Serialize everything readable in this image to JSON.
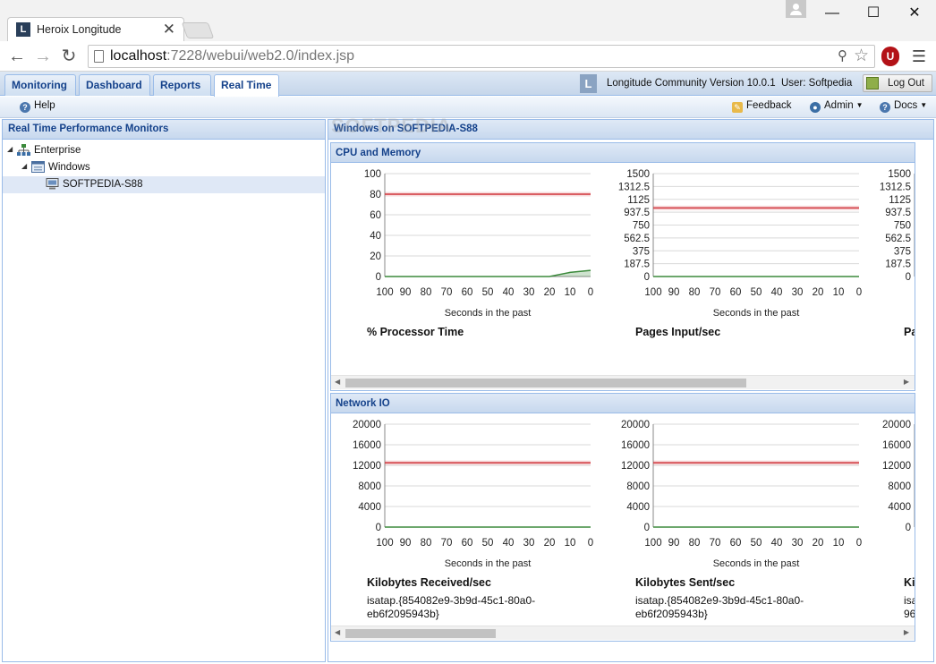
{
  "browser": {
    "tab_title": "Heroix Longitude",
    "tab_close": "✕",
    "favicon_letter": "L",
    "url_host": "localhost",
    "url_rest": ":7228/webui/web2.0/index.jsp"
  },
  "app": {
    "tabs": [
      {
        "label": "Monitoring"
      },
      {
        "label": "Dashboard"
      },
      {
        "label": "Reports"
      },
      {
        "label": "Real Time",
        "active": true
      }
    ],
    "logo_letter": "L",
    "version_text": "Longitude Community Version 10.0.1",
    "user_text": "User: Softpedia",
    "logout_label": "Log Out",
    "help_label": "Help",
    "feedback_label": "Feedback",
    "admin_label": "Admin",
    "docs_label": "Docs"
  },
  "left_panel": {
    "title": "Real Time Performance Monitors",
    "tree": [
      {
        "label": "Enterprise",
        "level": 0,
        "expanded": true,
        "icon": "network-icon"
      },
      {
        "label": "Windows",
        "level": 1,
        "expanded": true,
        "icon": "window-group-icon"
      },
      {
        "label": "SOFTPEDIA-S88",
        "level": 2,
        "selected": true,
        "icon": "computer-icon"
      }
    ]
  },
  "right_panel": {
    "title": "Windows on SOFTPEDIA-S88",
    "watermark": "SOFTPEDIA",
    "sections": [
      {
        "title": "CPU and Memory",
        "charts": [
          {
            "title": "% Processor Time",
            "subtitle": ""
          },
          {
            "title": "Pages Input/sec",
            "subtitle": ""
          },
          {
            "title": "Pa",
            "subtitle": ""
          }
        ]
      },
      {
        "title": "Network IO",
        "charts": [
          {
            "title": "Kilobytes Received/sec",
            "subtitle": "isatap.{854082e9-3b9d-45c1-80a0-eb6f2095943b}"
          },
          {
            "title": "Kilobytes Sent/sec",
            "subtitle": "isatap.{854082e9-3b9d-45c1-80a0-eb6f2095943b}"
          },
          {
            "title": "Ki",
            "subtitle": "isa\n96"
          }
        ]
      }
    ]
  },
  "chart_data": [
    {
      "type": "line",
      "title": "% Processor Time",
      "xlabel": "Seconds in the past",
      "x_ticks": [
        100,
        90,
        80,
        70,
        60,
        50,
        40,
        30,
        20,
        10,
        0
      ],
      "y_ticks": [
        0,
        20,
        40,
        60,
        80,
        100
      ],
      "ylim": [
        0,
        100
      ],
      "threshold": 80,
      "series": [
        {
          "x": [
            100,
            90,
            80,
            70,
            60,
            50,
            40,
            30,
            20,
            10,
            0
          ],
          "values": [
            0,
            0,
            0,
            0,
            0,
            0,
            0,
            0,
            0,
            4,
            6
          ]
        }
      ]
    },
    {
      "type": "line",
      "title": "Pages Input/sec",
      "xlabel": "Seconds in the past",
      "x_ticks": [
        100,
        90,
        80,
        70,
        60,
        50,
        40,
        30,
        20,
        10,
        0
      ],
      "y_ticks": [
        "0",
        "187.5",
        "375",
        "562.5",
        "750",
        "937.5",
        "1125",
        "1312.5",
        "1500"
      ],
      "ylim": [
        0,
        1500
      ],
      "threshold": 1000,
      "series": [
        {
          "x": [
            100,
            90,
            80,
            70,
            60,
            50,
            40,
            30,
            20,
            10,
            0
          ],
          "values": [
            0,
            0,
            0,
            0,
            0,
            0,
            0,
            0,
            0,
            0,
            0
          ]
        }
      ]
    },
    {
      "type": "line",
      "title": "Pa",
      "y_ticks": [
        "0",
        "187.5",
        "375",
        "562.5",
        "750",
        "937.5",
        "1125",
        "1312.5",
        "1500"
      ],
      "ylim": [
        0,
        1500
      ]
    },
    {
      "type": "line",
      "title": "Kilobytes Received/sec",
      "xlabel": "Seconds in the past",
      "x_ticks": [
        100,
        90,
        80,
        70,
        60,
        50,
        40,
        30,
        20,
        10,
        0
      ],
      "y_ticks": [
        0,
        4000,
        8000,
        12000,
        16000,
        20000
      ],
      "ylim": [
        0,
        20000
      ],
      "threshold": 12500,
      "series": [
        {
          "x": [
            100,
            90,
            80,
            70,
            60,
            50,
            40,
            30,
            20,
            10,
            0
          ],
          "values": [
            0,
            0,
            0,
            0,
            0,
            0,
            0,
            0,
            0,
            0,
            0
          ]
        }
      ]
    },
    {
      "type": "line",
      "title": "Kilobytes Sent/sec",
      "xlabel": "Seconds in the past",
      "x_ticks": [
        100,
        90,
        80,
        70,
        60,
        50,
        40,
        30,
        20,
        10,
        0
      ],
      "y_ticks": [
        0,
        4000,
        8000,
        12000,
        16000,
        20000
      ],
      "ylim": [
        0,
        20000
      ],
      "threshold": 12500,
      "series": [
        {
          "x": [
            100,
            90,
            80,
            70,
            60,
            50,
            40,
            30,
            20,
            10,
            0
          ],
          "values": [
            0,
            0,
            0,
            0,
            0,
            0,
            0,
            0,
            0,
            0,
            0
          ]
        }
      ]
    },
    {
      "type": "line",
      "title": "Ki",
      "y_ticks": [
        0,
        4000,
        8000,
        12000,
        16000,
        20000
      ],
      "ylim": [
        0,
        20000
      ]
    }
  ],
  "colors": {
    "threshold": "#d0353b",
    "series": "#3c8a3c",
    "grid": "#d9d9d9",
    "header_text": "#15428b"
  }
}
